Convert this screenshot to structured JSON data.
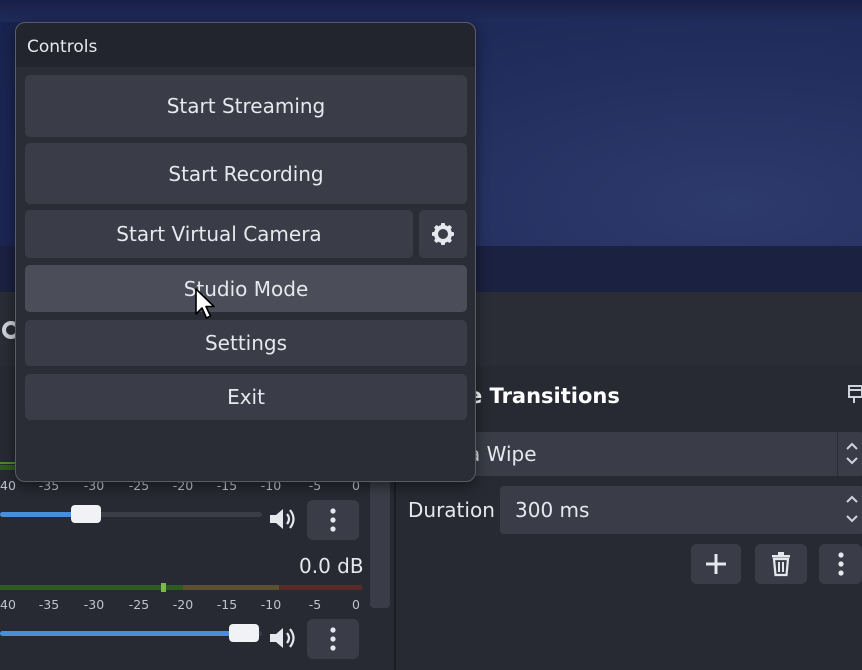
{
  "controls": {
    "title": "Controls",
    "start_streaming": "Start Streaming",
    "start_recording": "Start Recording",
    "start_virtual_camera": "Start Virtual Camera",
    "studio_mode": "Studio Mode",
    "settings": "Settings",
    "exit": "Exit"
  },
  "transitions": {
    "title": "e Transitions",
    "selected": "a Wipe",
    "duration_label": "Duration",
    "duration_value": "300 ms"
  },
  "mixer": {
    "ticks": [
      "40",
      "-35",
      "-30",
      "-25",
      "-20",
      "-15",
      "-10",
      "-5",
      "0"
    ],
    "channel2_db": "0.0 dB",
    "channel1_volume_fraction": 0.33,
    "channel2_volume_fraction": 0.93
  },
  "icons": {
    "vcam_settings": "gear-icon",
    "add": "plus-icon",
    "remove": "trash-icon",
    "more": "kebab-icon",
    "volume": "volume-icon",
    "cursor": "mouse-pointer"
  },
  "colors": {
    "accent": "#4a8ddb",
    "panel": "#2a2d36",
    "button": "#3a3d47",
    "button_hover": "#4b4e58",
    "meter_green": "#2f5a21",
    "meter_yellow": "#5a5423",
    "meter_red": "#5a2a29"
  }
}
